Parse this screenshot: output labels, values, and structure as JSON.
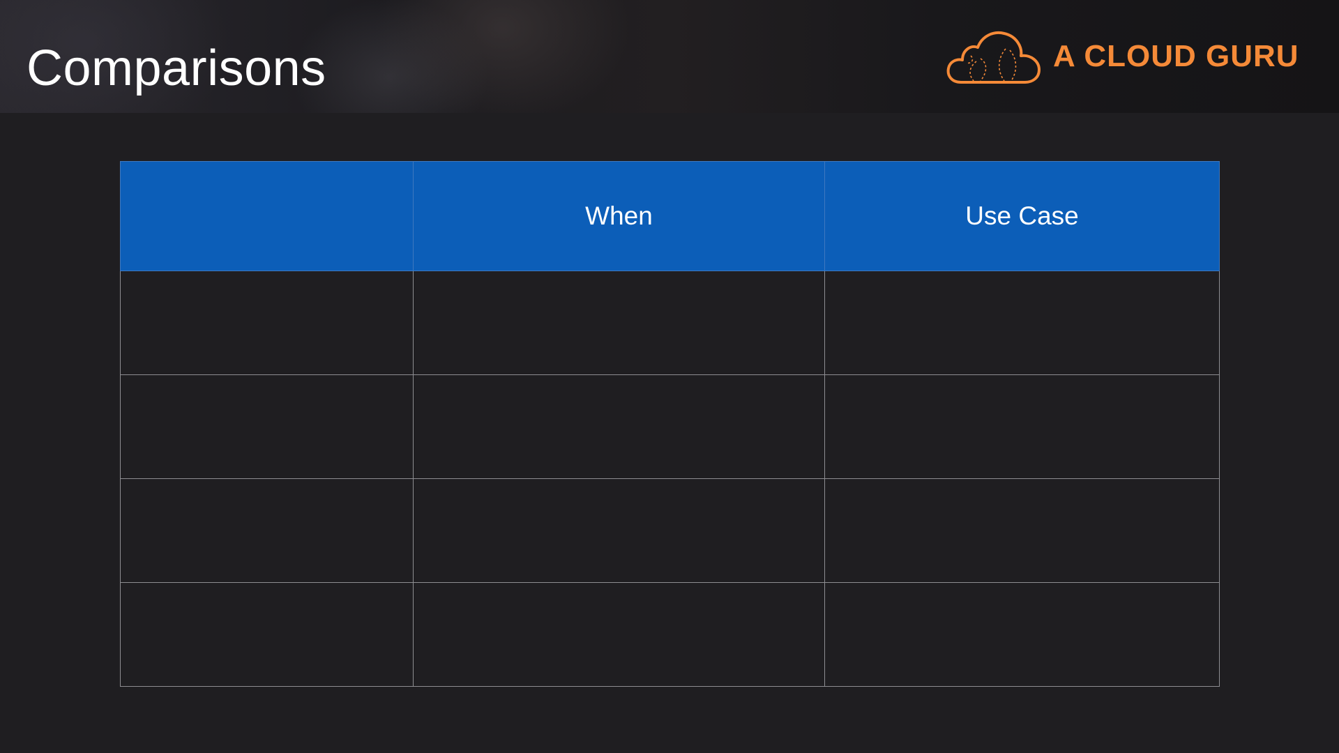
{
  "slide": {
    "title": "Comparisons"
  },
  "logo": {
    "text": "A CLOUD GURU",
    "icon": "cloud-icon",
    "color": "#f58a38"
  },
  "table": {
    "header_color": "#0c5eb8",
    "columns": [
      "",
      "When",
      "Use Case"
    ],
    "rows": [
      [
        "",
        "",
        ""
      ],
      [
        "",
        "",
        ""
      ],
      [
        "",
        "",
        ""
      ],
      [
        "",
        "",
        ""
      ]
    ]
  }
}
